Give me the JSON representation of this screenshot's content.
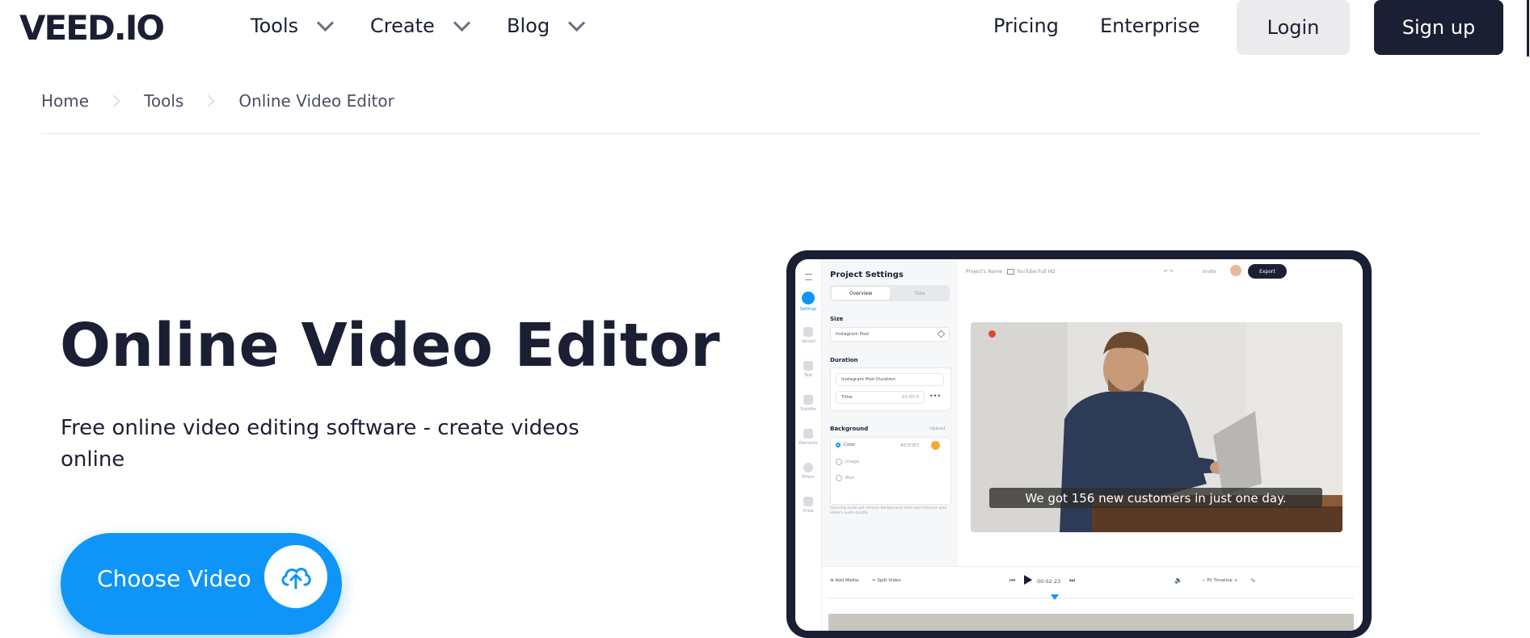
{
  "brand": {
    "logo": "VEED.IO",
    "primary": "#1b1f33",
    "accent": "#0f95f7"
  },
  "nav": {
    "items": [
      {
        "label": "Tools",
        "has_dropdown": true
      },
      {
        "label": "Create",
        "has_dropdown": true
      },
      {
        "label": "Blog",
        "has_dropdown": true
      }
    ],
    "pricing": "Pricing",
    "enterprise": "Enterprise",
    "login": "Login",
    "signup": "Sign up"
  },
  "breadcrumb": [
    "Home",
    "Tools",
    "Online Video Editor"
  ],
  "hero": {
    "title": "Online Video Editor",
    "subtitle": "Free online video editing software - create videos online",
    "cta_label": "Choose Video",
    "cta_icon": "cloud-upload-icon"
  },
  "editor_preview": {
    "rail": [
      "Settings",
      "Upload",
      "Text",
      "Subtitle",
      "Elements",
      "Filters",
      "Draw"
    ],
    "panel_title": "Project Settings",
    "tabs": [
      "Overview",
      "Size"
    ],
    "size_label": "Size",
    "size_value": "Instagram Post",
    "duration_label": "Duration",
    "duration_value": "Instagram Post Duration",
    "time_label": "Time",
    "time_value": "01:00.0",
    "background_label": "Background",
    "upload_link": "Upload",
    "bg_options": [
      {
        "label": "Color",
        "value": "#E2E3E3",
        "selected": true
      },
      {
        "label": "Image",
        "value": "",
        "selected": false
      },
      {
        "label": "Blur",
        "value": "",
        "selected": false
      }
    ],
    "note": "Cleaning audio will remove background noise and enhance your video's audio quality",
    "project_name": "Project's Name",
    "format": "YouTube Full HD",
    "invite": "Invite",
    "export": "Export",
    "caption": "We got 156 new customers in just one day.",
    "add_media": "Add Media",
    "split_video": "Split Video",
    "timecode": "00:02:23",
    "fit_timeline": "Fit Timeline"
  }
}
